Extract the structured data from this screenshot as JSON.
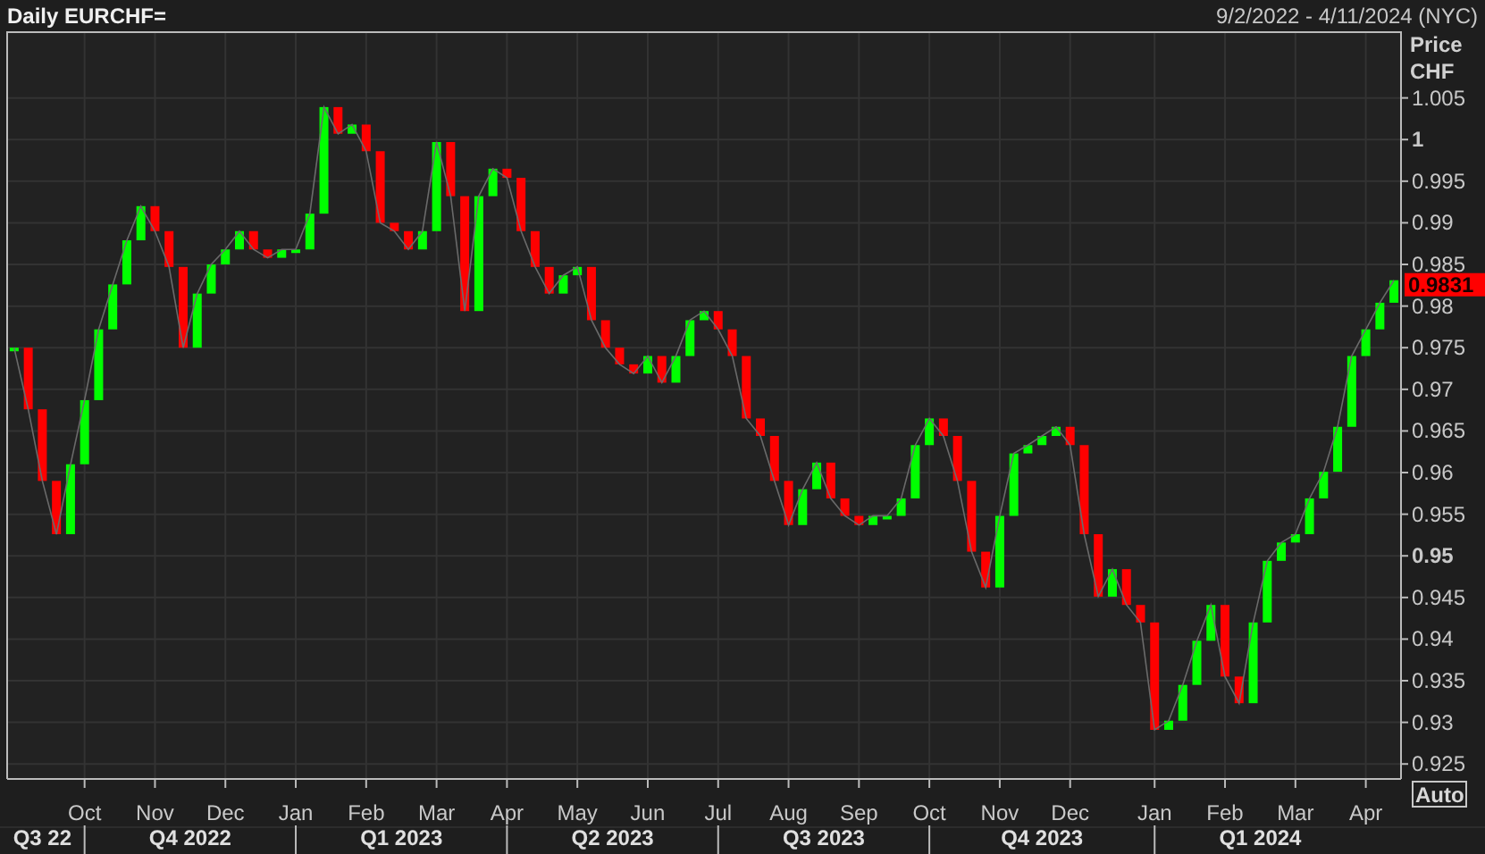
{
  "header": {
    "title": "Daily EURCHF=",
    "date_range": "9/2/2022 - 4/11/2024 (NYC)"
  },
  "axis_title": [
    "Price",
    "CHF"
  ],
  "last_price_badge": "0.9831",
  "auto_button": "Auto",
  "chart_data": {
    "type": "line",
    "grid": true,
    "categories": [
      null,
      null,
      null,
      null,
      null,
      "Oct",
      null,
      null,
      null,
      null,
      "Nov",
      null,
      null,
      null,
      null,
      "Dec",
      null,
      null,
      null,
      null,
      "Jan",
      null,
      null,
      null,
      null,
      "Feb",
      null,
      null,
      null,
      null,
      "Mar",
      null,
      null,
      null,
      null,
      "Apr",
      null,
      null,
      null,
      null,
      "May",
      null,
      null,
      null,
      null,
      "Jun",
      null,
      null,
      null,
      null,
      "Jul",
      null,
      null,
      null,
      null,
      "Aug",
      null,
      null,
      null,
      null,
      "Sep",
      null,
      null,
      null,
      null,
      "Oct",
      null,
      null,
      null,
      null,
      "Nov",
      null,
      null,
      null,
      null,
      "Dec",
      null,
      null,
      null,
      null,
      null,
      "Jan",
      null,
      null,
      null,
      null,
      "Feb",
      null,
      null,
      null,
      null,
      "Mar",
      null,
      null,
      null,
      null,
      "Apr",
      null,
      null
    ],
    "series": [
      {
        "color": "#6a6a6a",
        "values": [
          0.975,
          0.9676,
          0.959,
          0.9526,
          0.961,
          0.9687,
          0.9772,
          0.9826,
          0.9879,
          0.992,
          0.989,
          0.9847,
          0.975,
          0.9815,
          0.985,
          0.9868,
          0.989,
          0.9868,
          0.9858,
          0.9868,
          0.9868,
          0.9911,
          1.0039,
          1.0007,
          1.0018,
          0.9986,
          0.99,
          0.989,
          0.9868,
          0.989,
          0.9997,
          0.9932,
          0.9794,
          0.9932,
          0.9965,
          0.9954,
          0.989,
          0.9847,
          0.9815,
          0.9837,
          0.9847,
          0.9783,
          0.975,
          0.973,
          0.9719,
          0.974,
          0.9708,
          0.974,
          0.9783,
          0.9794,
          0.9772,
          0.974,
          0.9665,
          0.9644,
          0.959,
          0.9537,
          0.958,
          0.9612,
          0.9569,
          0.9548,
          0.9537,
          0.9548,
          0.9548,
          0.9569,
          0.9633,
          0.9665,
          0.9644,
          0.959,
          0.9505,
          0.9462,
          0.9548,
          0.9623,
          0.9633,
          0.9644,
          0.9655,
          0.9633,
          0.9526,
          0.9451,
          0.9484,
          0.9441,
          0.942,
          0.9291,
          0.9302,
          0.9345,
          0.9398,
          0.9441,
          0.9355,
          0.9323,
          0.942,
          0.9494,
          0.9516,
          0.9526,
          0.9569,
          0.9601,
          0.9655,
          0.974,
          0.9772,
          0.9804,
          0.9831
        ]
      }
    ],
    "ylim": [
      0.9232,
      1.0129
    ],
    "yticks": [
      {
        "value": 0.925,
        "label": "0.925"
      },
      {
        "value": 0.93,
        "label": "0.93"
      },
      {
        "value": 0.935,
        "label": "0.935"
      },
      {
        "value": 0.94,
        "label": "0.94"
      },
      {
        "value": 0.945,
        "label": "0.945"
      },
      {
        "value": 0.95,
        "label": "0.95"
      },
      {
        "value": 0.955,
        "label": "0.955"
      },
      {
        "value": 0.96,
        "label": "0.96"
      },
      {
        "value": 0.965,
        "label": "0.965"
      },
      {
        "value": 0.97,
        "label": "0.97"
      },
      {
        "value": 0.975,
        "label": "0.975"
      },
      {
        "value": 0.98,
        "label": "0.98"
      },
      {
        "value": 0.985,
        "label": "0.985"
      },
      {
        "value": 0.99,
        "label": "0.99"
      },
      {
        "value": 0.995,
        "label": "0.995"
      },
      {
        "value": 1,
        "label": "1"
      },
      {
        "value": 1.005,
        "label": "1.005"
      }
    ]
  },
  "quarters": [
    {
      "label": "Q3 22"
    },
    {
      "label": "Q4 2022"
    },
    {
      "label": "Q1 2023"
    },
    {
      "label": "Q2 2023"
    },
    {
      "label": "Q3 2023"
    },
    {
      "label": "Q4 2023"
    },
    {
      "label": "Q1 2024"
    }
  ]
}
